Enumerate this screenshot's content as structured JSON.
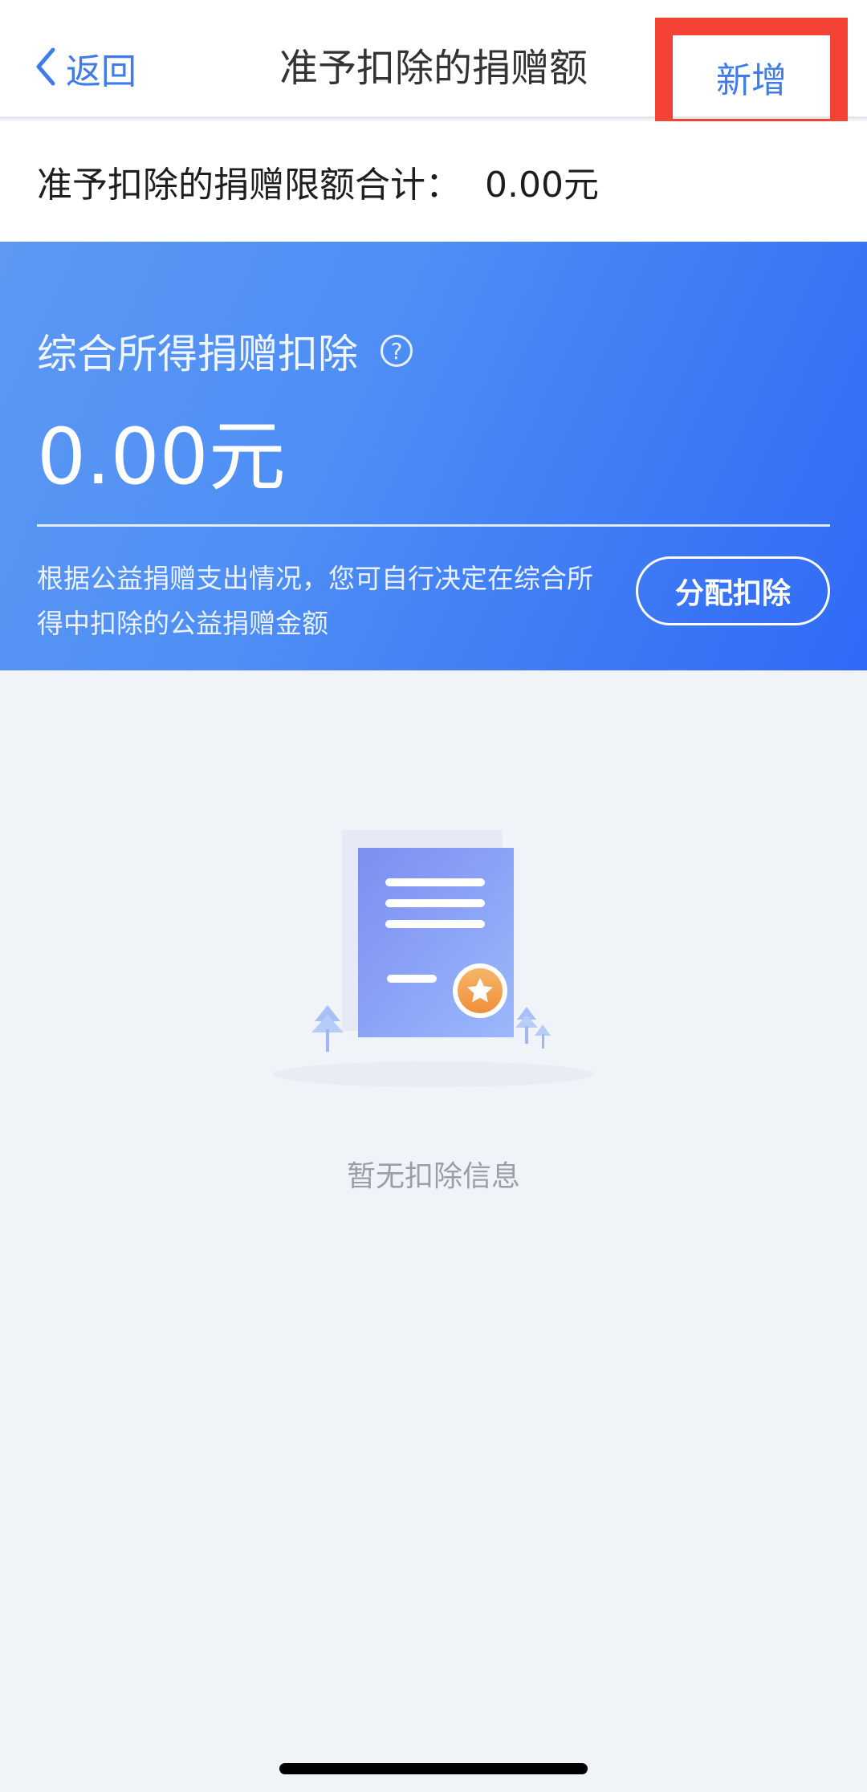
{
  "nav": {
    "back_label": "返回",
    "title": "准予扣除的捐赠额",
    "add_label": "新增"
  },
  "total": {
    "label": "准予扣除的捐赠限额合计：",
    "value": "0.00元"
  },
  "card": {
    "title": "综合所得捐赠扣除",
    "help_icon": "question-circle-icon",
    "help_symbol": "?",
    "amount": "0.00元",
    "description": "根据公益捐赠支出情况，您可自行决定在综合所得中扣除的公益捐赠金额",
    "allocate_label": "分配扣除"
  },
  "empty": {
    "illustration": "document-star-icon",
    "message": "暂无扣除信息"
  },
  "colors": {
    "accent": "#3f7bea",
    "card_gradient_start": "#5c98f4",
    "card_gradient_end": "#2f6af7",
    "highlight_box": "#f44336",
    "background": "#f0f3f8"
  }
}
